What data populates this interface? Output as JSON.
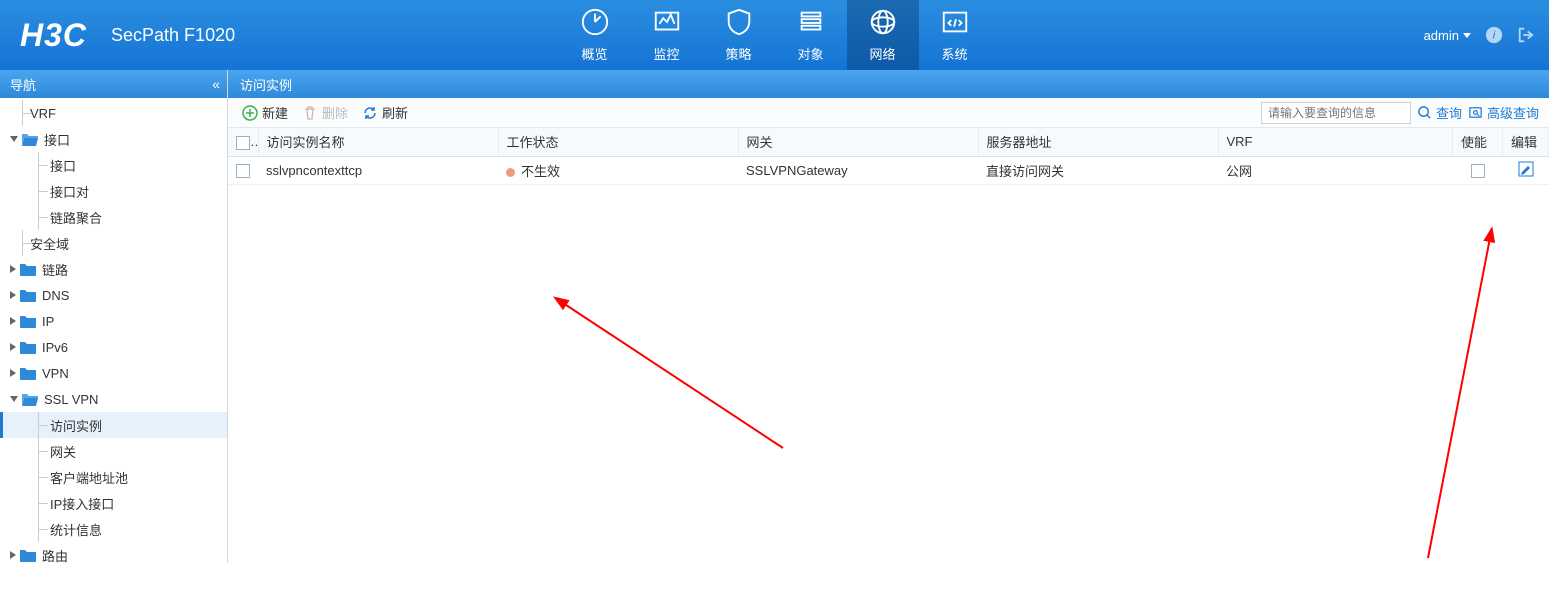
{
  "banner": {
    "logo": "H3C",
    "model": "SecPath F1020",
    "nav": [
      {
        "label": "概览",
        "icon": "gauge"
      },
      {
        "label": "监控",
        "icon": "monitor"
      },
      {
        "label": "策略",
        "icon": "shield"
      },
      {
        "label": "对象",
        "icon": "stack"
      },
      {
        "label": "网络",
        "icon": "globe",
        "active": true
      },
      {
        "label": "系统",
        "icon": "code"
      }
    ],
    "user": "admin",
    "info_tip": "info",
    "logout_tip": "logout"
  },
  "sidebar": {
    "title": "导航",
    "collapse_label": "«",
    "items": [
      {
        "label": "VRF",
        "type": "leaf",
        "indent": 1
      },
      {
        "label": "接口",
        "type": "folder-open",
        "indent": 0,
        "tog": "open"
      },
      {
        "label": "接口",
        "type": "leaf",
        "indent": 2
      },
      {
        "label": "接口对",
        "type": "leaf",
        "indent": 2
      },
      {
        "label": "链路聚合",
        "type": "leaf",
        "indent": 2
      },
      {
        "label": "安全域",
        "type": "leaf",
        "indent": 1
      },
      {
        "label": "链路",
        "type": "folder",
        "indent": 0,
        "tog": "closed"
      },
      {
        "label": "DNS",
        "type": "folder",
        "indent": 0,
        "tog": "closed"
      },
      {
        "label": "IP",
        "type": "folder",
        "indent": 0,
        "tog": "closed"
      },
      {
        "label": "IPv6",
        "type": "folder",
        "indent": 0,
        "tog": "closed"
      },
      {
        "label": "VPN",
        "type": "folder",
        "indent": 0,
        "tog": "closed"
      },
      {
        "label": "SSL VPN",
        "type": "folder-open",
        "indent": 0,
        "tog": "open"
      },
      {
        "label": "访问实例",
        "type": "leaf",
        "indent": 2,
        "active": true
      },
      {
        "label": "网关",
        "type": "leaf",
        "indent": 2
      },
      {
        "label": "客户端地址池",
        "type": "leaf",
        "indent": 2
      },
      {
        "label": "IP接入接口",
        "type": "leaf",
        "indent": 2
      },
      {
        "label": "统计信息",
        "type": "leaf",
        "indent": 2
      },
      {
        "label": "路由",
        "type": "folder",
        "indent": 0,
        "tog": "closed"
      }
    ]
  },
  "main": {
    "title": "访问实例",
    "toolbar": {
      "new": "新建",
      "delete": "删除",
      "refresh": "刷新",
      "search_placeholder": "请输入要查询的信息",
      "query": "查询",
      "adv_query": "高级查询"
    },
    "columns": [
      "访问实例名称",
      "工作状态",
      "网关",
      "服务器地址",
      "VRF",
      "使能",
      "编辑"
    ],
    "rows": [
      {
        "name": "sslvpncontexttcp",
        "status_text": "不生效",
        "status": "inactive",
        "gateway": "SSLVPNGateway",
        "server": "直接访问网关",
        "vrf": "公网",
        "enabled": false
      }
    ]
  }
}
